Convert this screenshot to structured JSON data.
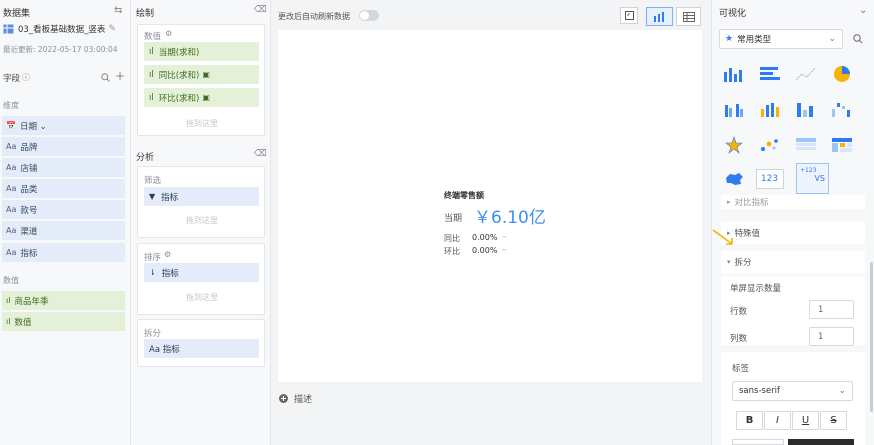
{
  "left": {
    "dataset_title": "数据集",
    "dataset_name": "03_看板基础数据_竖表",
    "last_update": "最近更新: 2022-05-17 03:00:04",
    "fields_title": "字段",
    "dim_title": "维度",
    "dimensions": [
      {
        "tag": "📅",
        "label": "日期 ⌄"
      },
      {
        "tag": "Aa",
        "label": "品牌"
      },
      {
        "tag": "Aa",
        "label": "店铺"
      },
      {
        "tag": "Aa",
        "label": "品类"
      },
      {
        "tag": "Aa",
        "label": "款号"
      },
      {
        "tag": "Aa",
        "label": "渠道"
      },
      {
        "tag": "Aa",
        "label": "指标"
      }
    ],
    "meas_title": "数值",
    "measures": [
      {
        "label": "商品年季"
      },
      {
        "label": "数值"
      }
    ]
  },
  "mid": {
    "draw_title": "绘制",
    "values_title": "数值",
    "value_items": [
      {
        "label": "当期(求和)"
      },
      {
        "label": "同比(求和)"
      },
      {
        "label": "环比(求和)"
      }
    ],
    "drop_hint": "拖到这里",
    "analysis_title": "分析",
    "filter_title": "筛选",
    "filter_item": "指标",
    "sort_title": "排序",
    "sort_item": "指标",
    "split_title": "拆分",
    "split_item": "Aa 指标"
  },
  "center": {
    "auto_refresh_label": "更改后自动刷新数据",
    "kpi_title": "终端零售额",
    "current_label": "当期",
    "current_value": "￥6.10亿",
    "yoy_label": "同比",
    "yoy_value": "0.00%",
    "mom_label": "环比",
    "mom_value": "0.00%",
    "describe_label": "描述"
  },
  "right": {
    "title": "可视化",
    "chart_type_select": "常用类型",
    "compare_label": "对比指标",
    "special_label": "特殊值",
    "split_label": "拆分",
    "per_screen_label": "单屏显示数量",
    "rows_label": "行数",
    "rows_value": "1",
    "cols_label": "列数",
    "cols_value": "1",
    "tag_label": "标签",
    "font_value": "sans-serif",
    "format_bold": "B",
    "format_italic": "I",
    "format_underline": "U",
    "format_strike": "S",
    "kpi_icon_text": "123",
    "vs_icon_top": "+123",
    "vs_icon_bottom": "VS"
  },
  "colors": {
    "accent": "#2f7bf0",
    "field_blue": "#e3ecf8",
    "field_green": "#e4f1d8",
    "kpi_blue": "#3d8ff2"
  }
}
